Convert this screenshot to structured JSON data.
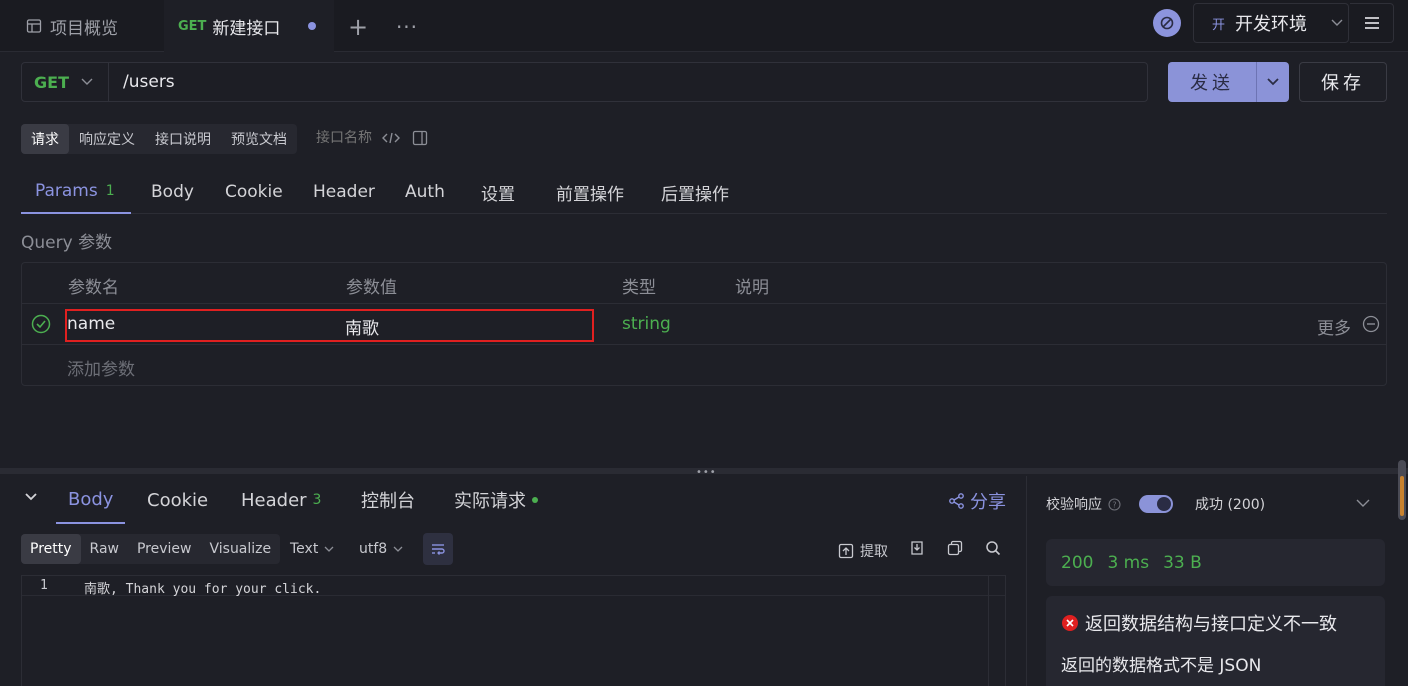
{
  "tabs": {
    "overview_label": "项目概览",
    "active_method": "GET",
    "active_label": "新建接口",
    "add_symbol": "+",
    "more_symbol": "···"
  },
  "environment": {
    "badge": "开",
    "name": "开发环境"
  },
  "request": {
    "method": "GET",
    "url": "/users",
    "send_label": "发送",
    "save_label": "保存"
  },
  "modes": {
    "items": [
      "请求",
      "响应定义",
      "接口说明",
      "预览文档"
    ],
    "active": "请求",
    "name_placeholder": "接口名称"
  },
  "request_tabs": {
    "params_label": "Params",
    "params_count": "1",
    "body": "Body",
    "cookie": "Cookie",
    "header": "Header",
    "auth": "Auth",
    "settings": "设置",
    "pre_ops": "前置操作",
    "post_ops": "后置操作"
  },
  "query": {
    "section_label": "Query 参数",
    "columns": [
      "参数名",
      "参数值",
      "类型",
      "说明"
    ],
    "rows": [
      {
        "name": "name",
        "value": "南歌",
        "type": "string",
        "description": "",
        "more": "更多"
      }
    ],
    "add_label": "添加参数"
  },
  "response_tabs": {
    "body": "Body",
    "cookie": "Cookie",
    "header": "Header",
    "header_count": "3",
    "console": "控制台",
    "actual_request": "实际请求",
    "share": "分享"
  },
  "format": {
    "modes": [
      "Pretty",
      "Raw",
      "Preview",
      "Visualize"
    ],
    "active": "Pretty",
    "type": "Text",
    "encoding": "utf8",
    "extract": "提取"
  },
  "response_body": {
    "lines": [
      {
        "no": "1",
        "text": "南歌, Thank you for your click."
      }
    ]
  },
  "validation": {
    "label": "校验响应",
    "enabled": true,
    "result": "成功 (200)",
    "status": "200",
    "time": "3 ms",
    "size": "33 B",
    "error_title": "返回数据结构与接口定义不一致",
    "error_desc": "返回的数据格式不是 JSON"
  },
  "colors": {
    "accent": "#8b93e0",
    "success": "#4caf50",
    "error": "#e02020",
    "background": "#1e1f26"
  }
}
